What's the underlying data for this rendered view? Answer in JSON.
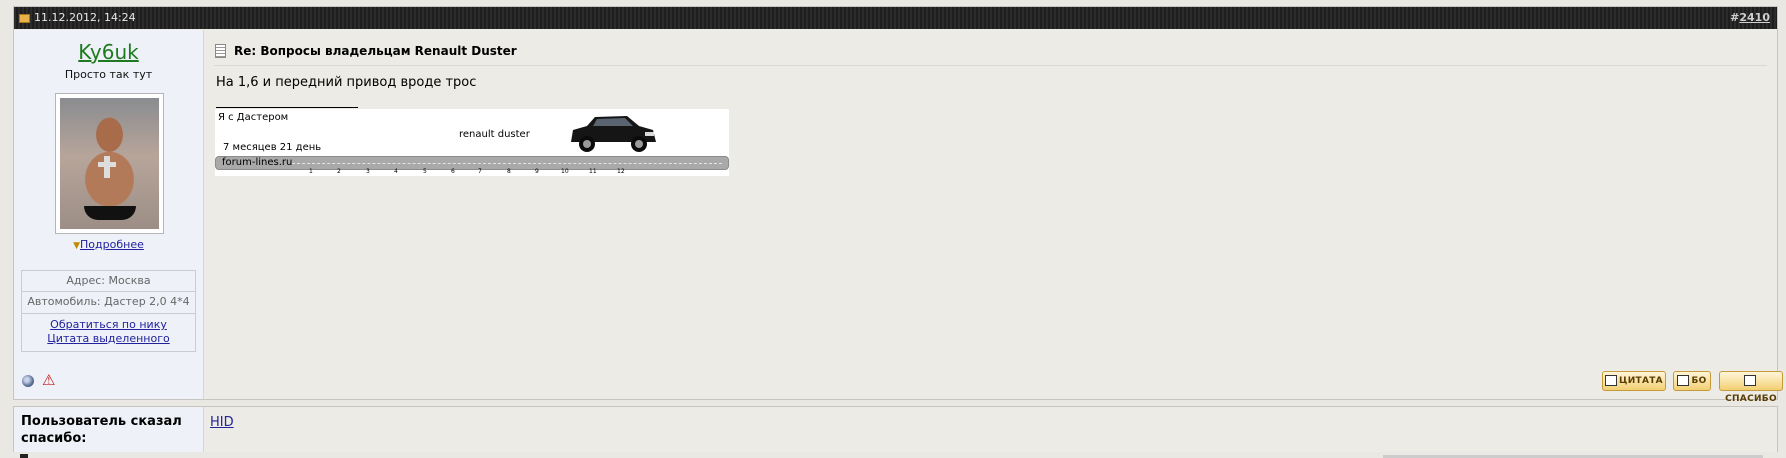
{
  "header": {
    "date": "11.12.2012, 14:24",
    "post_number_hash": "#",
    "post_number": "2410"
  },
  "user": {
    "name": "Ky6uk",
    "title": "Просто так тут",
    "more_link": "Подробнее",
    "address": "Адрес: Москва",
    "car": "Автомобиль: Дастер 2,0 4*4",
    "address_nick": "Обратиться по нику",
    "quote_selected": "Цитата выделенного"
  },
  "post": {
    "title": "Re: Вопросы владельцам Renault Duster",
    "message": "На 1,6 и передний привод вроде трос"
  },
  "signature": {
    "caption": "Я с Дастером",
    "car_label": "renault duster",
    "time_owned": "7 месяцев  21 день",
    "site": "forum-lines.ru",
    "ticks": [
      "1",
      "2",
      "3",
      "4",
      "5",
      "6",
      "7",
      "8",
      "9",
      "10",
      "11",
      "12"
    ]
  },
  "buttons": {
    "quote": "ЦИТАТА",
    "bo": "БО",
    "thanks": "СПАСИБО"
  },
  "thanks": {
    "label": "Пользователь сказал спасибо:",
    "users": "HID"
  },
  "colors": {
    "header_bg": "#2b2b2b",
    "username": "#1e7a1e",
    "link": "#22229c",
    "user_col_bg": "#eef2f8",
    "button_bg": "#f2cf72"
  }
}
